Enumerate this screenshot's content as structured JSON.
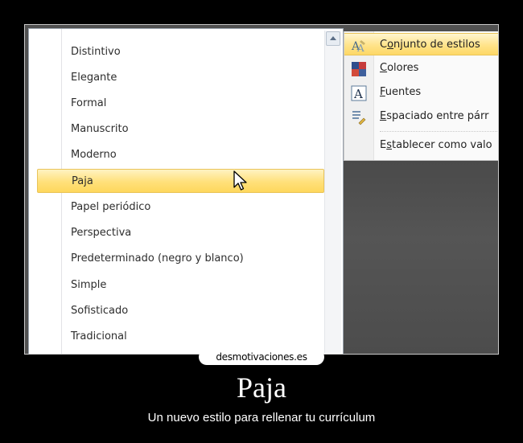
{
  "style_list": {
    "items": [
      "Distintivo",
      "Elegante",
      "Formal",
      "Manuscrito",
      "Moderno",
      "Paja",
      "Papel periódico",
      "Perspectiva",
      "Predeterminado (negro y blanco)",
      "Simple",
      "Sofisticado",
      "Tradicional"
    ],
    "selected": "Paja"
  },
  "menu": {
    "items": [
      {
        "label_pre": "C",
        "label_ul": "o",
        "label_post": "njunto de estilos",
        "icon": "style-set-icon"
      },
      {
        "label_pre": "",
        "label_ul": "C",
        "label_post": "olores",
        "icon": "colors-icon"
      },
      {
        "label_pre": "",
        "label_ul": "F",
        "label_post": "uentes",
        "icon": "fonts-icon"
      },
      {
        "label_pre": "",
        "label_ul": "E",
        "label_post": "spaciado entre párr",
        "icon": "paragraph-spacing-icon"
      },
      {
        "label_pre": "E",
        "label_ul": "s",
        "label_post": "tablecer como valo",
        "icon": ""
      }
    ]
  },
  "watermark": "desmotivaciones.es",
  "caption": {
    "title": "Paja",
    "subtitle": "Un nuevo estilo para rellenar tu currículum"
  }
}
